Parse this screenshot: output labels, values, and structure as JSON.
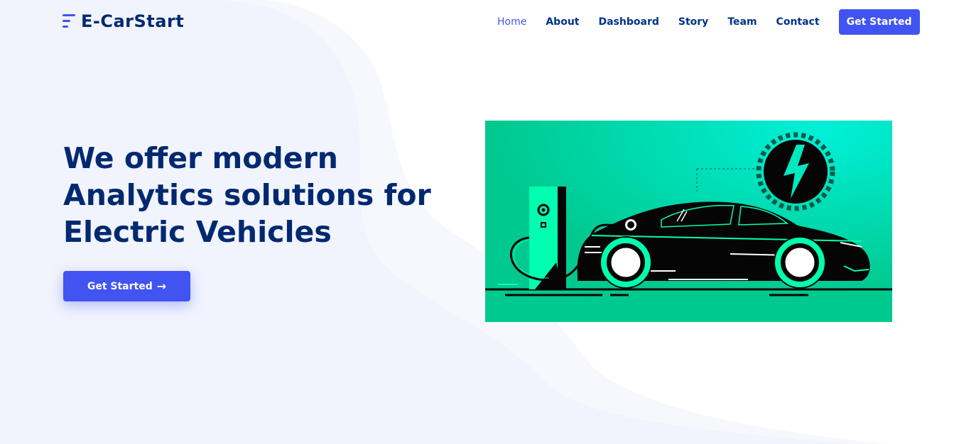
{
  "header": {
    "brand": "E-CarStart",
    "nav": [
      {
        "label": "Home",
        "active": true
      },
      {
        "label": "About",
        "active": false
      },
      {
        "label": "Dashboard",
        "active": false
      },
      {
        "label": "Story",
        "active": false
      },
      {
        "label": "Team",
        "active": false
      },
      {
        "label": "Contact",
        "active": false
      }
    ],
    "cta_label": "Get Started"
  },
  "hero": {
    "title": "We offer modern Analytics solutions for Electric Vehicles",
    "button_label": "Get Started",
    "button_icon": "arrow-right-icon",
    "image_icon": "electric-car-charging-illustration"
  },
  "colors": {
    "primary": "#4154f1",
    "heading": "#012970",
    "nav_text": "#013289",
    "background_tint": "#f1f4fc",
    "illustration_bg": "#00d8a8",
    "car_body": "#050505"
  }
}
